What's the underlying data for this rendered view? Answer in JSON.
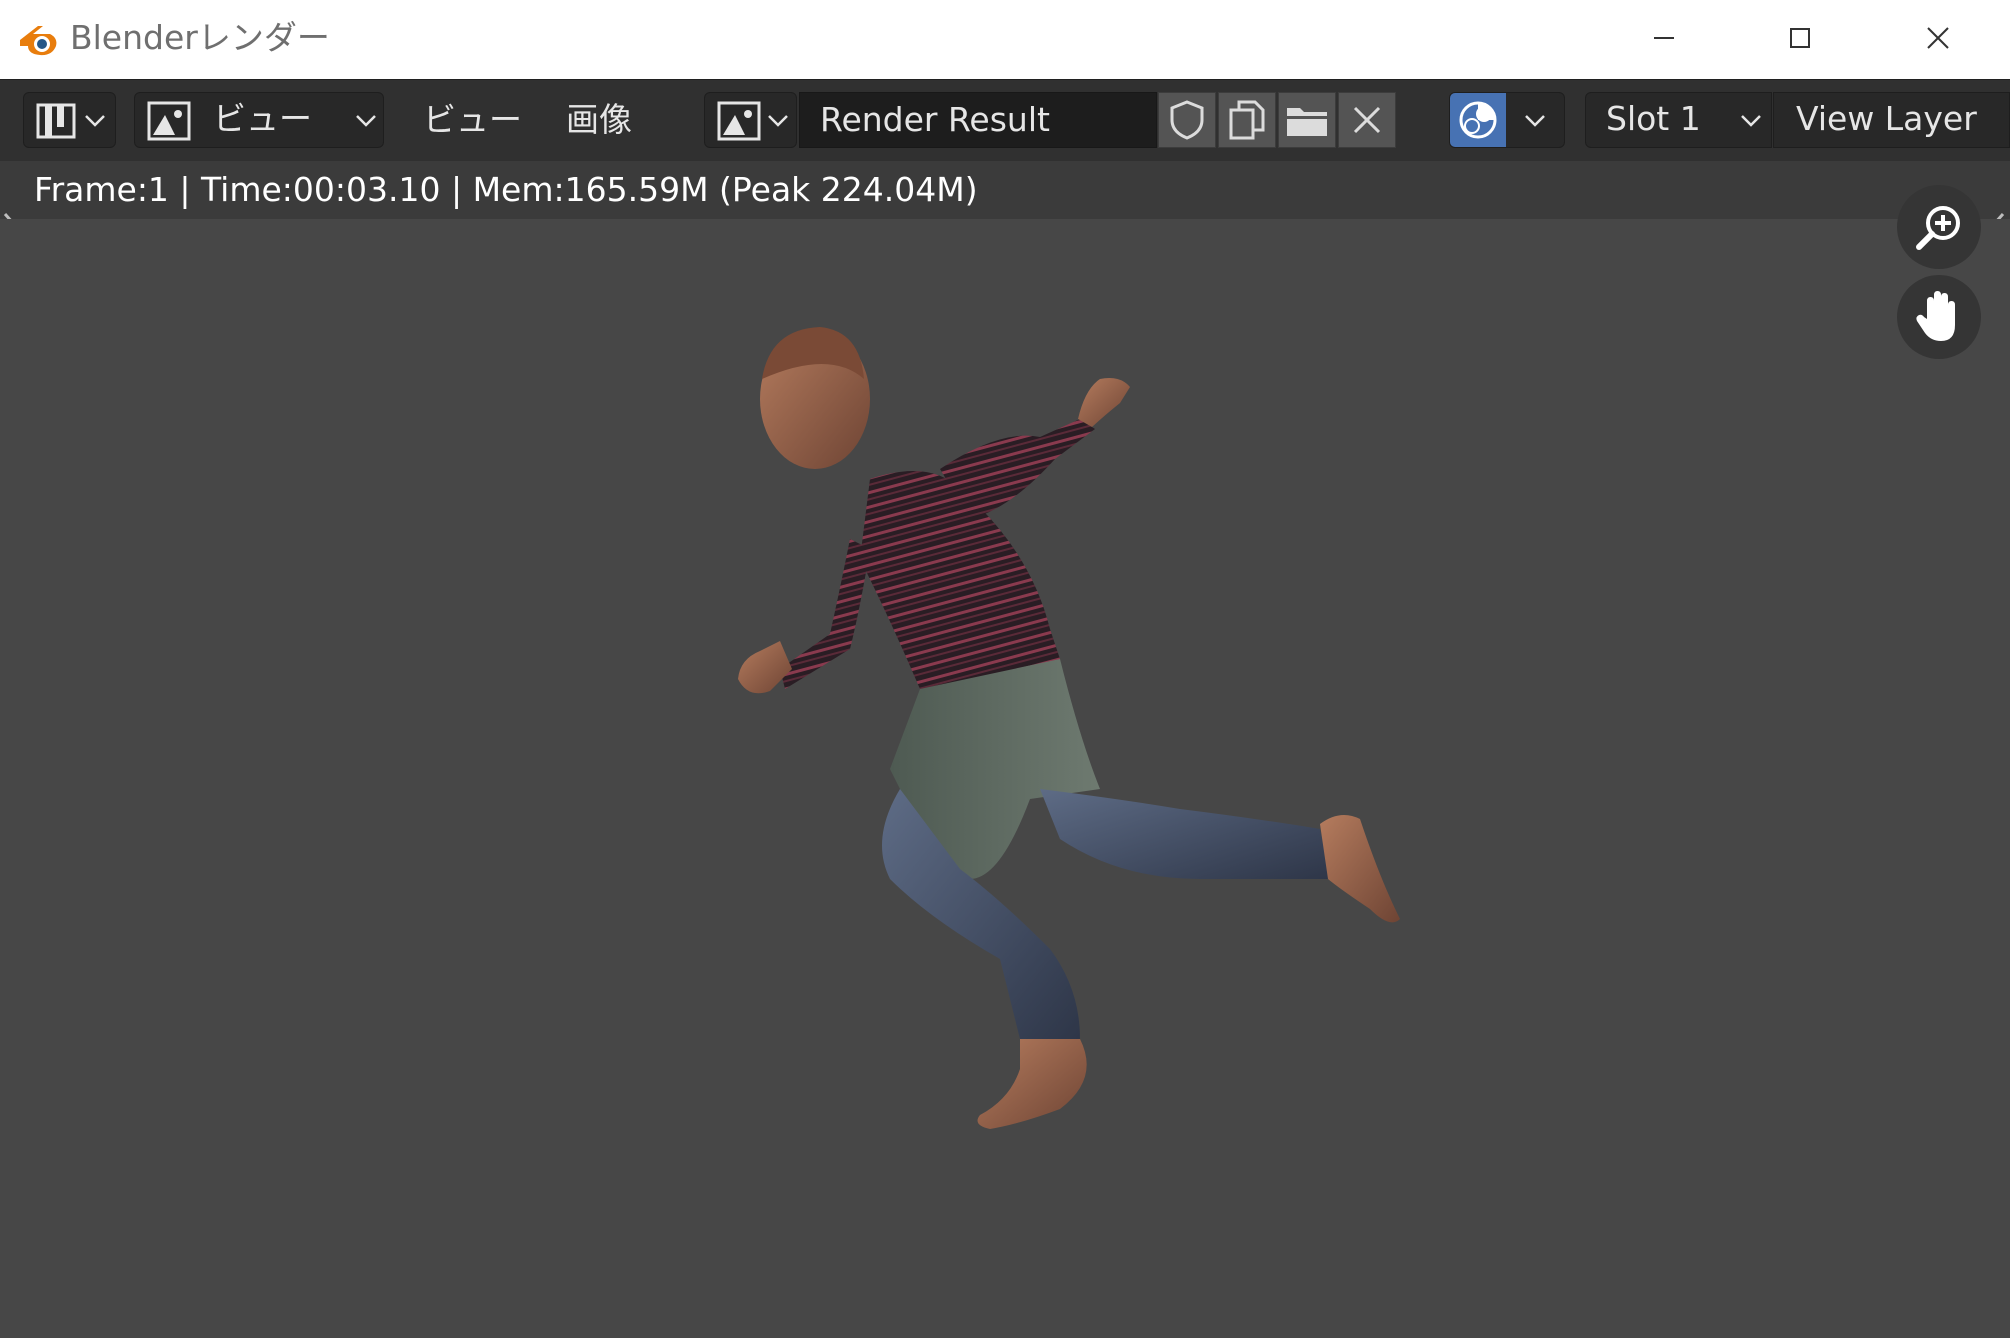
{
  "window": {
    "title": "Blenderレンダー",
    "buttons": {
      "minimize": "minimize-icon",
      "maximize": "maximize-icon",
      "close": "close-icon"
    }
  },
  "header": {
    "editor_type_icon": "image-editor-icon",
    "view_mode_icon": "image-icon",
    "view_mode_label": "ビュー",
    "menus": [
      "ビュー",
      "画像"
    ],
    "image_browse_icon": "image-icon",
    "image_name": "Render Result",
    "image_actions": [
      "fake-user-shield-icon",
      "duplicate-icon",
      "open-folder-icon",
      "unlink-x-icon"
    ],
    "display_channels_icon": "color-alpha-icon",
    "slot": "Slot 1",
    "view_layer": "View Layer"
  },
  "status": {
    "text": "Frame:1 | Time:00:03.10 | Mem:165.59M (Peak 224.04M)"
  },
  "viewport": {
    "gizmos": [
      "zoom-icon",
      "pan-hand-icon"
    ],
    "render_subject": "rendered-human-figure",
    "colors": {
      "background": "#474747",
      "header": "#303030",
      "active_toggle": "#4772b3",
      "blender_orange": "#e87d0d"
    }
  }
}
